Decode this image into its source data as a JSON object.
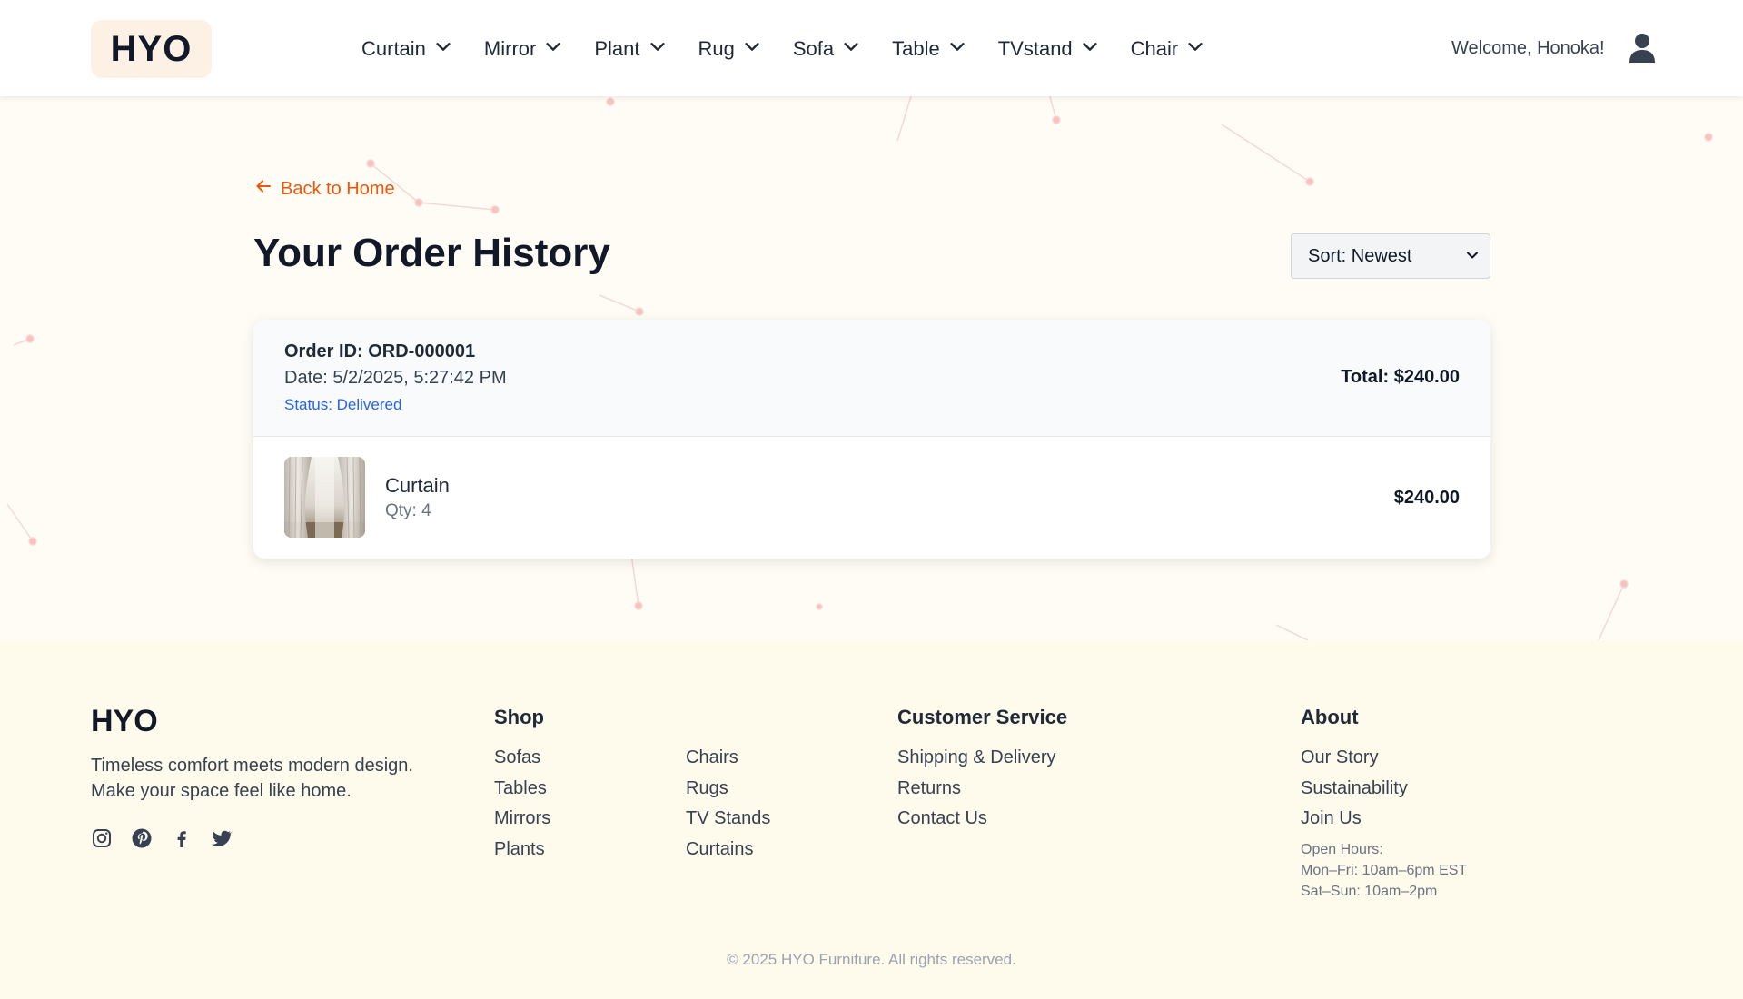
{
  "header": {
    "logo": "HYO",
    "nav": [
      {
        "label": "Curtain"
      },
      {
        "label": "Mirror"
      },
      {
        "label": "Plant"
      },
      {
        "label": "Rug"
      },
      {
        "label": "Sofa"
      },
      {
        "label": "Table"
      },
      {
        "label": "TVstand"
      },
      {
        "label": "Chair"
      }
    ],
    "welcome": "Welcome, Honoka!",
    "user_icon": "user-icon"
  },
  "main": {
    "back_link": "Back to Home",
    "title": "Your Order History",
    "sort": {
      "selected": "Sort: Newest"
    },
    "orders": [
      {
        "id": "Order ID: ORD-000001",
        "date": "Date: 5/2/2025, 5:27:42 PM",
        "status": "Status: Delivered",
        "total": "Total: $240.00",
        "items": [
          {
            "name": "Curtain",
            "qty": "Qty: 4",
            "price": "$240.00"
          }
        ]
      }
    ]
  },
  "footer": {
    "brand": "HYO",
    "tagline_1": "Timeless comfort meets modern design.",
    "tagline_2": "Make your space feel like home.",
    "social": [
      "instagram-icon",
      "pinterest-icon",
      "facebook-icon",
      "twitter-icon"
    ],
    "shop": {
      "title": "Shop",
      "col1": [
        "Sofas",
        "Tables",
        "Mirrors",
        "Plants"
      ],
      "col2": [
        "Chairs",
        "Rugs",
        "TV Stands",
        "Curtains"
      ]
    },
    "service": {
      "title": "Customer Service",
      "links": [
        "Shipping & Delivery",
        "Returns",
        "Contact Us"
      ]
    },
    "about": {
      "title": "About",
      "links": [
        "Our Story",
        "Sustainability",
        "Join Us"
      ],
      "hours_title": "Open Hours:",
      "hours_weekday": "Mon–Fri: 10am–6pm EST",
      "hours_weekend": "Sat–Sun: 10am–2pm"
    },
    "copyright": "© 2025 HYO Furniture. All rights reserved."
  },
  "colors": {
    "accent": "#ea580c",
    "status": "#2563eb",
    "background": "#fffbf5",
    "footer": "#fefbed"
  }
}
